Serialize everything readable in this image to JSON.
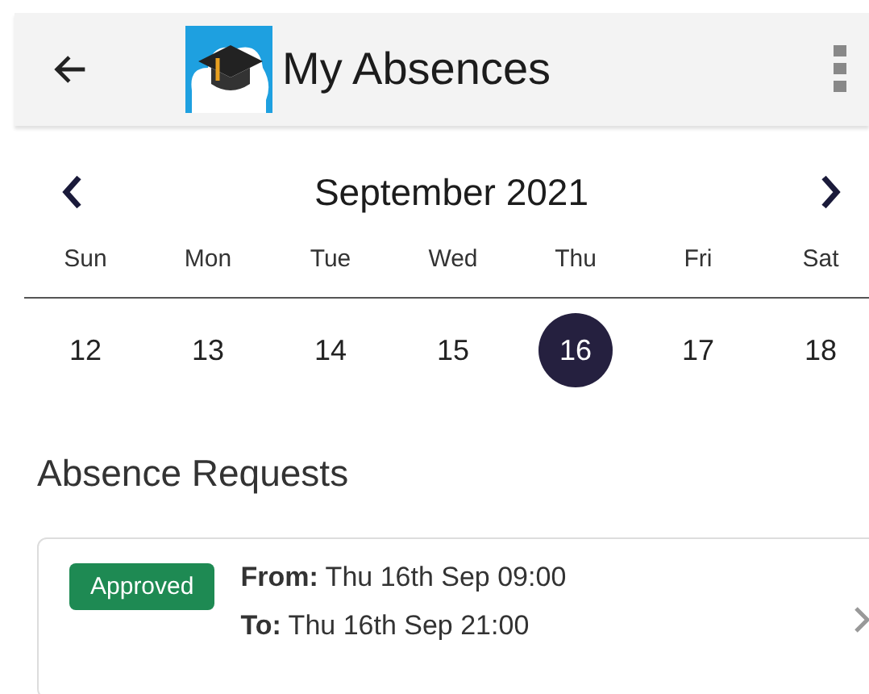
{
  "app_bar": {
    "title": "My Absences"
  },
  "calendar": {
    "month": "September 2021",
    "days": [
      {
        "weekday": "Sun",
        "date": "12",
        "selected": false
      },
      {
        "weekday": "Mon",
        "date": "13",
        "selected": false
      },
      {
        "weekday": "Tue",
        "date": "14",
        "selected": false
      },
      {
        "weekday": "Wed",
        "date": "15",
        "selected": false
      },
      {
        "weekday": "Thu",
        "date": "16",
        "selected": true
      },
      {
        "weekday": "Fri",
        "date": "17",
        "selected": false
      },
      {
        "weekday": "Sat",
        "date": "18",
        "selected": false
      }
    ]
  },
  "section_title": "Absence Requests",
  "requests": [
    {
      "status": "Approved",
      "from": "**From:** Thu 16th Sep 09:00",
      "to": "**To:** Thu 16th Sep 21:00"
    }
  ]
}
